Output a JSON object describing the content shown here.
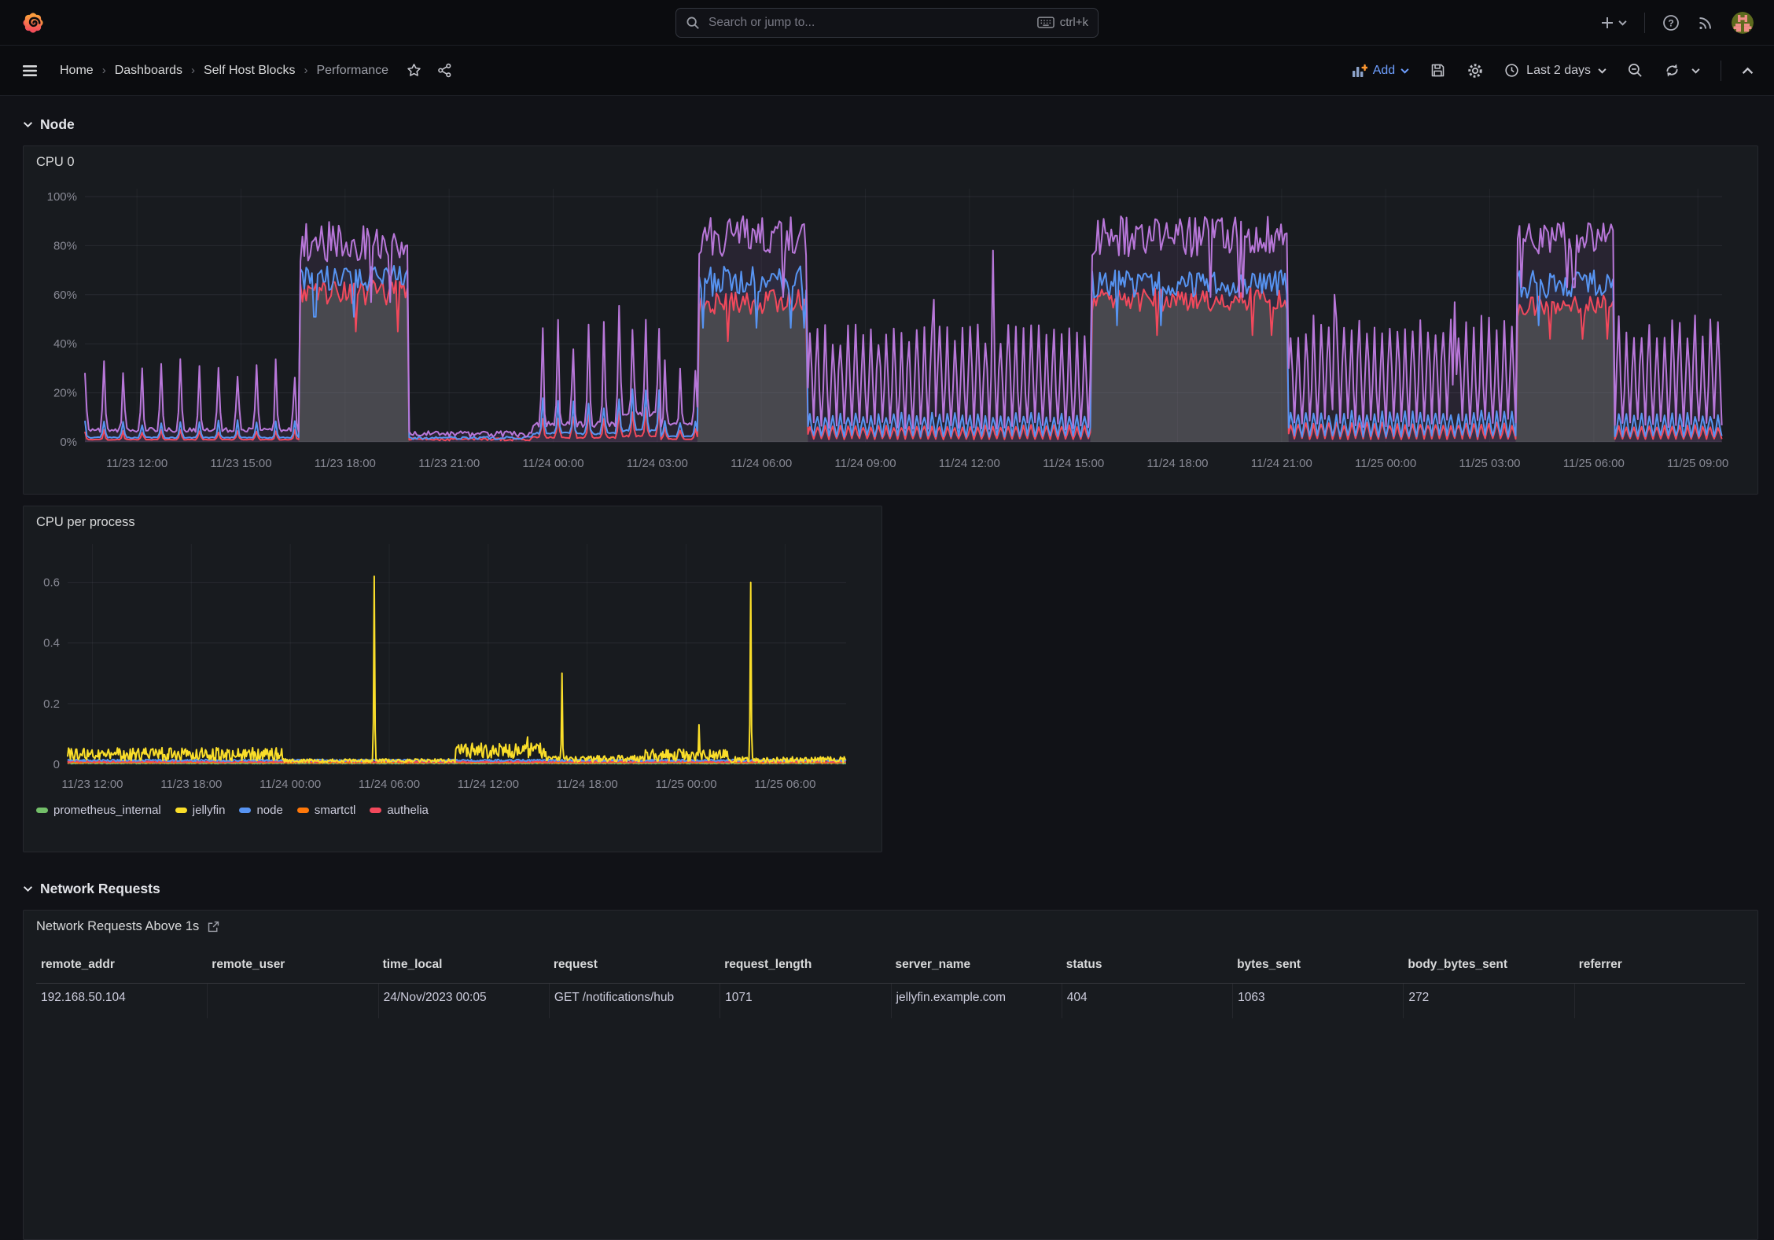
{
  "topbar": {
    "search_placeholder": "Search or jump to...",
    "shortcut_label": "ctrl+k"
  },
  "breadcrumb": {
    "separator": "›",
    "items": [
      {
        "label": "Home"
      },
      {
        "label": "Dashboards"
      },
      {
        "label": "Self Host Blocks"
      },
      {
        "label": "Performance"
      }
    ]
  },
  "toolbar": {
    "add_label": "Add",
    "time_range_label": "Last 2 days"
  },
  "sections": [
    {
      "title": "Node"
    },
    {
      "title": "Network Requests"
    }
  ],
  "colors": {
    "accent_blue": "#6e9fff",
    "panel_bg": "#181b1f",
    "page_bg": "#111217",
    "green": "#73BF69",
    "yellow": "#FADE2A",
    "blue": "#5794F2",
    "orange": "#FF780A",
    "red": "#F2495C",
    "purple": "#B877D9"
  },
  "chart_data": [
    {
      "id": "cpu0",
      "type": "area",
      "title": "CPU 0",
      "domain_hours": 47.2,
      "ylim": [
        0,
        100
      ],
      "y_ticks": {
        "values": [
          0,
          20,
          40,
          60,
          80,
          100
        ],
        "format": "pct"
      },
      "x_ticks": {
        "first_h": 1.5,
        "step_h": 3,
        "labels": [
          "11/23 12:00",
          "11/23 15:00",
          "11/23 18:00",
          "11/23 21:00",
          "11/24 00:00",
          "11/24 03:00",
          "11/24 06:00",
          "11/24 09:00",
          "11/24 12:00",
          "11/24 15:00",
          "11/24 18:00",
          "11/24 21:00",
          "11/25 00:00",
          "11/25 03:00",
          "11/25 06:00",
          "11/25 09:00"
        ]
      },
      "series": [
        {
          "name": "green-fill",
          "color": "none",
          "fill": "rgba(115,191,105,0.20)",
          "mask_of": "red",
          "windows": [
            [
              6.2,
              9.3
            ],
            [
              17.7,
              20.8
            ],
            [
              29.0,
              34.7
            ],
            [
              41.3,
              44.1
            ]
          ]
        },
        {
          "name": "red",
          "color": "#F2495C",
          "fill": "rgba(242,73,92,0.08)",
          "width": 2,
          "segments": [
            {
              "from": 0,
              "to": 6.2,
              "mode": "spikes",
              "range": [
                0.8,
                5
              ],
              "period": 0.55
            },
            {
              "from": 6.2,
              "to": 9.3,
              "mode": "high",
              "range": [
                52,
                66
              ]
            },
            {
              "from": 9.3,
              "to": 12.9,
              "mode": "quiet",
              "range": [
                0.5,
                2.5
              ]
            },
            {
              "from": 12.9,
              "to": 15.3,
              "mode": "spikes",
              "range": [
                1.5,
                12
              ],
              "period": 0.45
            },
            {
              "from": 15.3,
              "to": 16.6,
              "mode": "spikes",
              "range": [
                2,
                14
              ],
              "period": 0.4
            },
            {
              "from": 16.6,
              "to": 17.7,
              "mode": "spikes",
              "range": [
                1,
                6
              ],
              "period": 0.45
            },
            {
              "from": 17.7,
              "to": 20.8,
              "mode": "high",
              "range": [
                48,
                62
              ]
            },
            {
              "from": 20.8,
              "to": 29.0,
              "mode": "osc",
              "range": [
                1,
                7
              ]
            },
            {
              "from": 29.0,
              "to": 34.7,
              "mode": "high",
              "range": [
                50,
                63
              ]
            },
            {
              "from": 34.7,
              "to": 41.3,
              "mode": "osc",
              "range": [
                1,
                8
              ]
            },
            {
              "from": 41.3,
              "to": 44.1,
              "mode": "high",
              "range": [
                48,
                60
              ]
            },
            {
              "from": 44.1,
              "to": 47.2,
              "mode": "osc",
              "range": [
                1,
                7
              ]
            }
          ]
        },
        {
          "name": "blue",
          "color": "#5794F2",
          "fill": "rgba(87,148,242,0.08)",
          "width": 2,
          "segments": [
            {
              "from": 0,
              "to": 6.2,
              "mode": "spikes",
              "range": [
                1.5,
                9
              ],
              "period": 0.55
            },
            {
              "from": 6.2,
              "to": 9.3,
              "mode": "high",
              "range": [
                58,
                72
              ]
            },
            {
              "from": 9.3,
              "to": 12.9,
              "mode": "quiet",
              "range": [
                1,
                3
              ]
            },
            {
              "from": 12.9,
              "to": 15.3,
              "mode": "spikes",
              "range": [
                3,
                18
              ],
              "period": 0.45
            },
            {
              "from": 15.3,
              "to": 16.6,
              "mode": "spikes",
              "range": [
                4,
                22
              ],
              "period": 0.4
            },
            {
              "from": 16.6,
              "to": 17.7,
              "mode": "spikes",
              "range": [
                2,
                10
              ],
              "period": 0.45
            },
            {
              "from": 17.7,
              "to": 20.8,
              "mode": "high",
              "range": [
                55,
                72
              ]
            },
            {
              "from": 20.8,
              "to": 29.0,
              "mode": "osc",
              "range": [
                2,
                12
              ]
            },
            {
              "from": 29.0,
              "to": 34.7,
              "mode": "high",
              "range": [
                55,
                70
              ]
            },
            {
              "from": 34.7,
              "to": 41.3,
              "mode": "osc",
              "range": [
                2,
                13
              ]
            },
            {
              "from": 41.3,
              "to": 44.1,
              "mode": "high",
              "range": [
                55,
                70
              ]
            },
            {
              "from": 44.1,
              "to": 47.2,
              "mode": "osc",
              "range": [
                2,
                12
              ]
            }
          ]
        },
        {
          "name": "purple",
          "color": "#B877D9",
          "fill": "rgba(184,119,217,0.10)",
          "width": 2,
          "spikes": [
            {
              "t": 26.2,
              "v": 78
            },
            {
              "t": 24.5,
              "v": 58
            },
            {
              "t": 36.0,
              "v": 60
            },
            {
              "t": 39.5,
              "v": 57
            }
          ],
          "segments": [
            {
              "from": 0,
              "to": 6.2,
              "mode": "spikes",
              "range": [
                4,
                34
              ],
              "period": 0.55
            },
            {
              "from": 6.2,
              "to": 9.3,
              "mode": "high",
              "range": [
                68,
                90
              ]
            },
            {
              "from": 9.3,
              "to": 12.9,
              "mode": "quiet",
              "range": [
                2,
                6
              ]
            },
            {
              "from": 12.9,
              "to": 15.3,
              "mode": "spikes",
              "range": [
                6,
                50
              ],
              "period": 0.45
            },
            {
              "from": 15.3,
              "to": 16.6,
              "mode": "spikes",
              "range": [
                10,
                58
              ],
              "period": 0.4
            },
            {
              "from": 16.6,
              "to": 17.7,
              "mode": "spikes",
              "range": [
                6,
                35
              ],
              "period": 0.45
            },
            {
              "from": 17.7,
              "to": 20.8,
              "mode": "high",
              "range": [
                70,
                92
              ]
            },
            {
              "from": 20.8,
              "to": 29.0,
              "mode": "osc",
              "range": [
                5,
                48
              ]
            },
            {
              "from": 29.0,
              "to": 34.7,
              "mode": "high",
              "range": [
                70,
                92
              ]
            },
            {
              "from": 34.7,
              "to": 41.3,
              "mode": "osc",
              "range": [
                6,
                52
              ]
            },
            {
              "from": 41.3,
              "to": 44.1,
              "mode": "high",
              "range": [
                72,
                90
              ]
            },
            {
              "from": 44.1,
              "to": 47.2,
              "mode": "osc",
              "range": [
                6,
                52
              ]
            }
          ]
        }
      ]
    },
    {
      "id": "cpu_per_process",
      "type": "line",
      "title": "CPU per process",
      "domain_hours": 47.2,
      "ylim": [
        0,
        0.7
      ],
      "y_ticks": {
        "values": [
          0,
          0.2,
          0.4,
          0.6
        ],
        "format": "plain"
      },
      "x_ticks": {
        "first_h": 1.5,
        "step_h": 6,
        "labels": [
          "11/23 12:00",
          "11/23 18:00",
          "11/24 00:00",
          "11/24 06:00",
          "11/24 12:00",
          "11/24 18:00",
          "11/25 00:00",
          "11/25 06:00"
        ]
      },
      "legend": [
        {
          "label": "prometheus_internal",
          "color": "#73BF69"
        },
        {
          "label": "jellyfin",
          "color": "#FADE2A"
        },
        {
          "label": "node",
          "color": "#5794F2"
        },
        {
          "label": "smartctl",
          "color": "#FF780A"
        },
        {
          "label": "authelia",
          "color": "#F2495C"
        }
      ],
      "series": [
        {
          "name": "prometheus_internal",
          "color": "#73BF69",
          "width": 2,
          "segments": [
            {
              "from": 0,
              "to": 47.2,
              "mode": "noise",
              "range": [
                0.002,
                0.005
              ]
            }
          ]
        },
        {
          "name": "smartctl",
          "color": "#FF780A",
          "width": 2,
          "segments": [
            {
              "from": 0,
              "to": 47.2,
              "mode": "noise",
              "range": [
                0.004,
                0.008
              ]
            }
          ]
        },
        {
          "name": "authelia",
          "color": "#F2495C",
          "width": 2,
          "segments": [
            {
              "from": 0,
              "to": 47.2,
              "mode": "noise",
              "range": [
                0.006,
                0.011
              ]
            }
          ]
        },
        {
          "name": "node",
          "color": "#5794F2",
          "width": 2,
          "segments": [
            {
              "from": 0,
              "to": 47.2,
              "mode": "noise",
              "range": [
                0.01,
                0.016
              ]
            }
          ]
        },
        {
          "name": "jellyfin",
          "color": "#FADE2A",
          "width": 2,
          "spikes": [
            {
              "t": 18.6,
              "v": 0.62
            },
            {
              "t": 30.0,
              "v": 0.3
            },
            {
              "t": 41.4,
              "v": 0.6
            },
            {
              "t": 27.9,
              "v": 0.09
            },
            {
              "t": 38.3,
              "v": 0.13
            }
          ],
          "segments": [
            {
              "from": 0,
              "to": 13,
              "mode": "noise",
              "range": [
                0.012,
                0.055
              ]
            },
            {
              "from": 13,
              "to": 23.5,
              "mode": "noise",
              "range": [
                0.006,
                0.018
              ]
            },
            {
              "from": 23.5,
              "to": 29,
              "mode": "noise",
              "range": [
                0.02,
                0.07
              ]
            },
            {
              "from": 29,
              "to": 35,
              "mode": "noise",
              "range": [
                0.008,
                0.03
              ]
            },
            {
              "from": 35,
              "to": 40,
              "mode": "noise",
              "range": [
                0.01,
                0.05
              ]
            },
            {
              "from": 40,
              "to": 47.2,
              "mode": "noise",
              "range": [
                0.006,
                0.025
              ]
            }
          ]
        }
      ]
    },
    {
      "id": "network_requests",
      "type": "table",
      "title": "Network Requests Above 1s",
      "columns": [
        "remote_addr",
        "remote_user",
        "time_local",
        "request",
        "request_length",
        "server_name",
        "status",
        "bytes_sent",
        "body_bytes_sent",
        "referrer"
      ],
      "rows": [
        [
          "192.168.50.104",
          "",
          "24/Nov/2023 00:05",
          "GET /notifications/hub",
          "1071",
          "jellyfin.example.com",
          "404",
          "1063",
          "272",
          ""
        ]
      ]
    }
  ]
}
